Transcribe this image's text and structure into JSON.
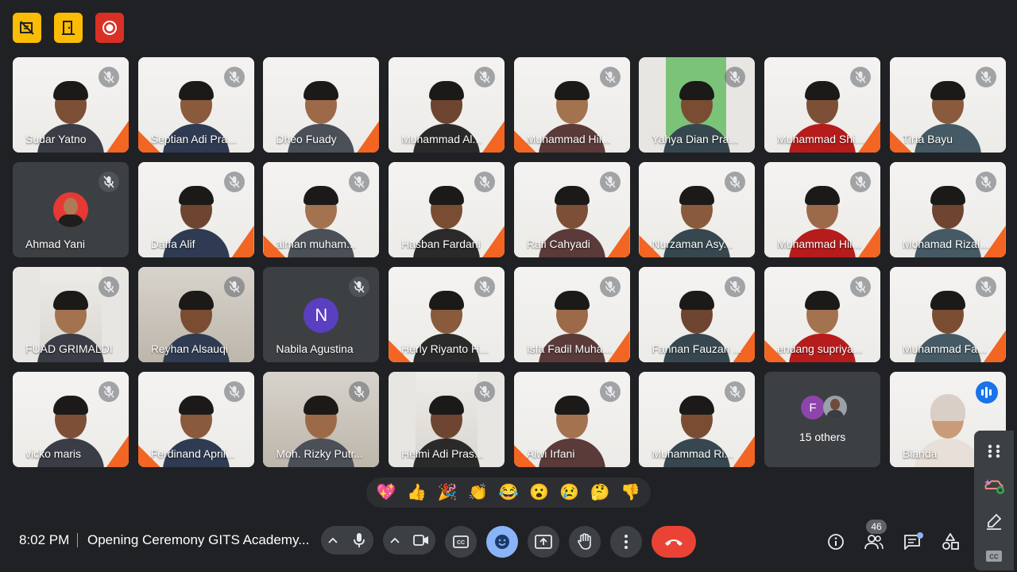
{
  "host_controls": {
    "items": [
      {
        "name": "host-controls-icon",
        "color": "#fbbc04"
      },
      {
        "name": "door-icon",
        "color": "#fbbc04"
      },
      {
        "name": "record-icon",
        "color": "#d93025"
      }
    ]
  },
  "participants": [
    {
      "name": "Sudar Yatno",
      "type": "slide",
      "muted": true
    },
    {
      "name": "Septian Adi Pra...",
      "type": "slide",
      "muted": true
    },
    {
      "name": "Dheo Fuady",
      "type": "slide",
      "muted": false
    },
    {
      "name": "Muhammad Al...",
      "type": "slide",
      "muted": true
    },
    {
      "name": "Muhammad Hil...",
      "type": "slide",
      "muted": true
    },
    {
      "name": "Yahya Dian Pra...",
      "type": "green",
      "muted": true
    },
    {
      "name": "Muhammad Shi...",
      "type": "slide",
      "muted": true
    },
    {
      "name": "Tirta Bayu",
      "type": "slide",
      "muted": true
    },
    {
      "name": "Ahmad Yani",
      "type": "avatar",
      "muted": true
    },
    {
      "name": "Daffa Alif",
      "type": "slide",
      "muted": true
    },
    {
      "name": "alman muham...",
      "type": "slide",
      "muted": true
    },
    {
      "name": "Hasban Fardani",
      "type": "slide",
      "muted": true
    },
    {
      "name": "Rafi Cahyadi",
      "type": "slide",
      "muted": true
    },
    {
      "name": "Nurzaman Asy...",
      "type": "slide",
      "muted": true
    },
    {
      "name": "Muhammad Hil...",
      "type": "slide",
      "muted": true
    },
    {
      "name": "Mohamad Rizal...",
      "type": "slide",
      "muted": true
    },
    {
      "name": "FUAD GRIMALDI",
      "type": "narrow",
      "muted": true
    },
    {
      "name": "Reyhan Alsauqi",
      "type": "room",
      "muted": true
    },
    {
      "name": "Nabila Agustina",
      "type": "letter",
      "letter": "N",
      "muted": true
    },
    {
      "name": "Herly Riyanto H...",
      "type": "slide",
      "muted": true
    },
    {
      "name": "Isfa Fadil Muha...",
      "type": "slide",
      "muted": true
    },
    {
      "name": "Fannan Fauzan ...",
      "type": "slide",
      "muted": true
    },
    {
      "name": "endang supriya...",
      "type": "slide",
      "muted": true
    },
    {
      "name": "Muhammad Fa...",
      "type": "slide",
      "muted": true
    },
    {
      "name": "vicko maris",
      "type": "slide",
      "muted": true
    },
    {
      "name": "Ferdinand April...",
      "type": "slide",
      "muted": true
    },
    {
      "name": "Moh. Rizky Putr...",
      "type": "room",
      "muted": true
    },
    {
      "name": "Helmi Adi Pras...",
      "type": "narrow",
      "muted": true
    },
    {
      "name": "Alwi Irfani",
      "type": "slide",
      "muted": true
    },
    {
      "name": "Muhammad Ri...",
      "type": "slide",
      "muted": true
    }
  ],
  "others_tile": {
    "label": "15 others",
    "letter": "F"
  },
  "speaker_tile": {
    "name": "Bianda"
  },
  "reactions": [
    "💖",
    "👍",
    "🎉",
    "👏",
    "😂",
    "😮",
    "😢",
    "🤔",
    "👎"
  ],
  "bottom_bar": {
    "time": "8:02 PM",
    "meeting_title": "Opening Ceremony GITS Academy...",
    "participant_count": "46"
  }
}
